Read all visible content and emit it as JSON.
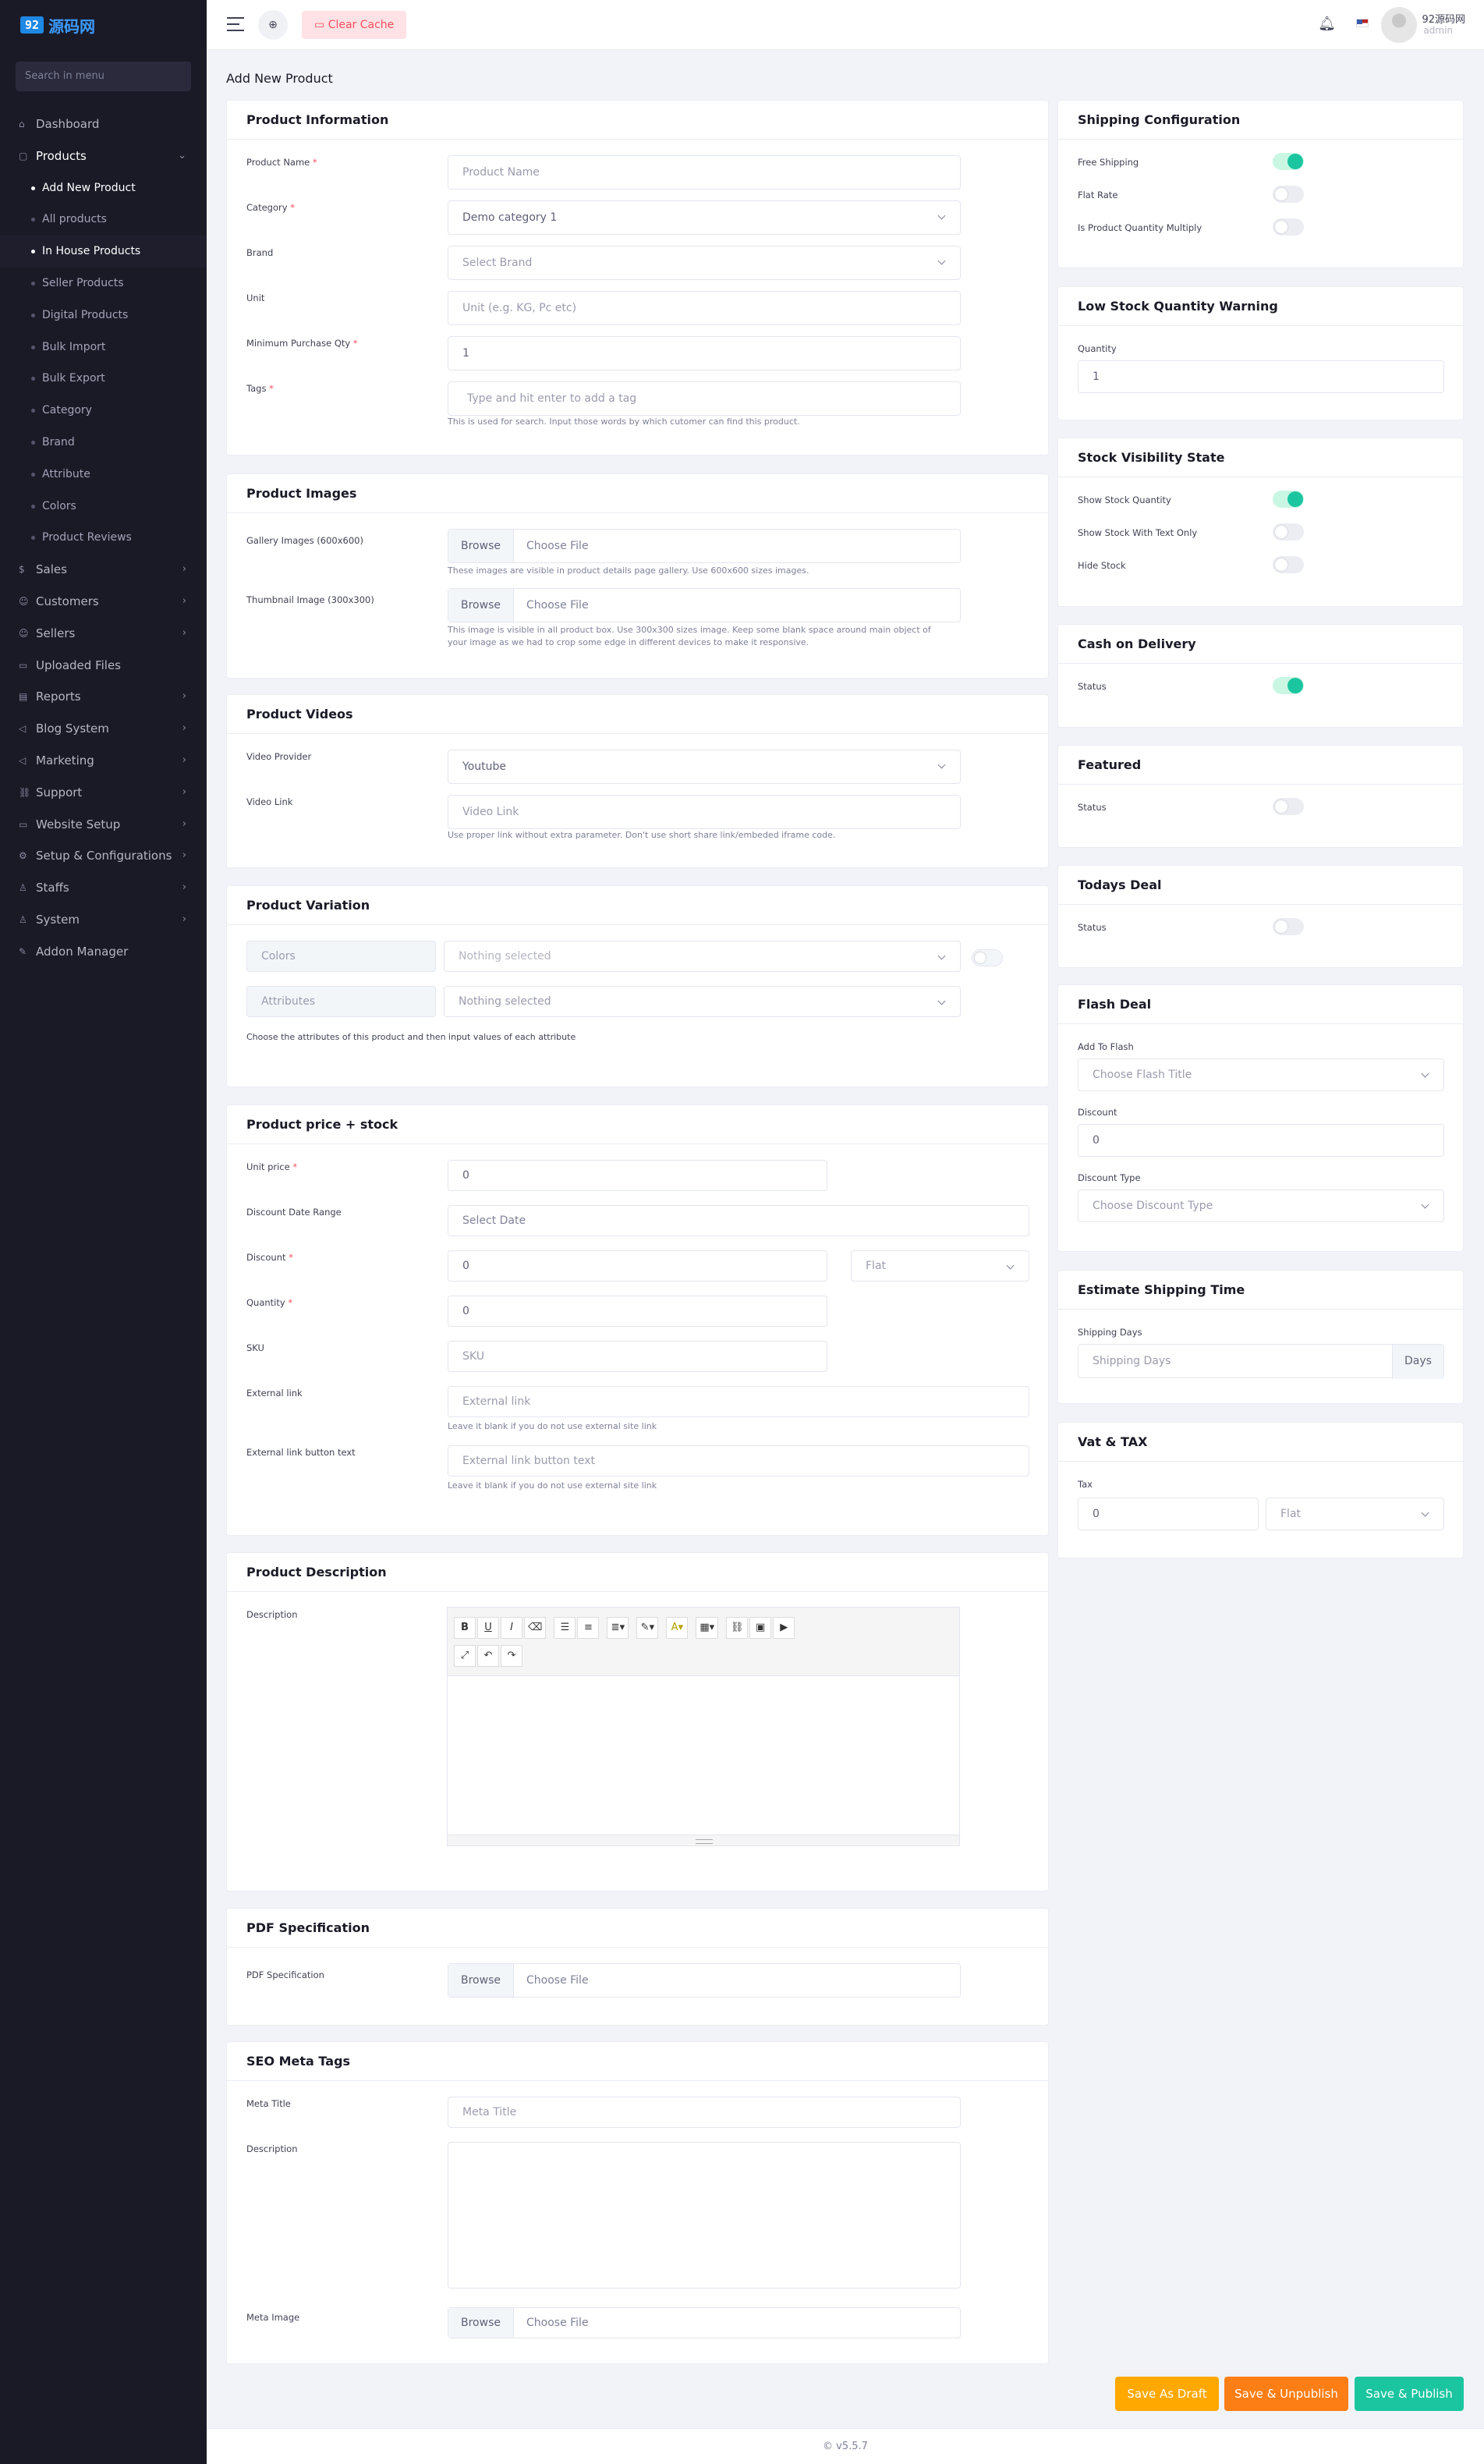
{
  "brand": {
    "logo_code": "92",
    "logo_name": "源码网"
  },
  "sidebar": {
    "search_placeholder": "Search in menu",
    "items": [
      {
        "label": "Dashboard",
        "icon": "home-icon",
        "chevron": false,
        "active": false
      },
      {
        "label": "Products",
        "icon": "box-icon",
        "chevron": true,
        "active": true,
        "expanded": true
      },
      {
        "label": "Sales",
        "icon": "money-icon",
        "chevron": true
      },
      {
        "label": "Customers",
        "icon": "users-icon",
        "chevron": true
      },
      {
        "label": "Sellers",
        "icon": "user-icon",
        "chevron": true
      },
      {
        "label": "Uploaded Files",
        "icon": "folder-icon",
        "chevron": false
      },
      {
        "label": "Reports",
        "icon": "file-icon",
        "chevron": true
      },
      {
        "label": "Blog System",
        "icon": "bullhorn-icon",
        "chevron": true
      },
      {
        "label": "Marketing",
        "icon": "bullhorn-icon",
        "chevron": true
      },
      {
        "label": "Support",
        "icon": "link-icon",
        "chevron": true
      },
      {
        "label": "Website Setup",
        "icon": "desktop-icon",
        "chevron": true
      },
      {
        "label": "Setup & Configurations",
        "icon": "gear-icon",
        "chevron": true
      },
      {
        "label": "Staffs",
        "icon": "user-tie-icon",
        "chevron": true
      },
      {
        "label": "System",
        "icon": "user-shield-icon",
        "chevron": true
      },
      {
        "label": "Addon Manager",
        "icon": "wrench-icon",
        "chevron": false
      }
    ],
    "product_sub": [
      "Add New Product",
      "All products",
      "In House Products",
      "Seller Products",
      "Digital Products",
      "Bulk Import",
      "Bulk Export",
      "Category",
      "Brand",
      "Attribute",
      "Colors",
      "Product Reviews"
    ]
  },
  "topbar": {
    "clear_cache": "Clear Cache",
    "user_name": "92源码网",
    "user_role": "admin"
  },
  "page_title": "Add New Product",
  "product_info": {
    "title": "Product Information",
    "name_label": "Product Name",
    "name_placeholder": "Product Name",
    "category_label": "Category",
    "category_value": "Demo category 1",
    "brand_label": "Brand",
    "brand_placeholder": "Select Brand",
    "unit_label": "Unit",
    "unit_placeholder": "Unit (e.g. KG, Pc etc)",
    "minqty_label": "Minimum Purchase Qty",
    "minqty_value": "1",
    "tags_label": "Tags",
    "tags_placeholder": "Type and hit enter to add a tag",
    "tags_help": "This is used for search. Input those words by which cutomer can find this product."
  },
  "product_images": {
    "title": "Product Images",
    "gallery_label": "Gallery Images (600x600)",
    "browse": "Browse",
    "choose_file": "Choose File",
    "gallery_help": "These images are visible in product details page gallery. Use 600x600 sizes images.",
    "thumb_label": "Thumbnail Image (300x300)",
    "thumb_help_1": "This image is visible in all product box. Use 300x300 sizes image. Keep some blank space around main object of",
    "thumb_help_2": "your image as we had to crop some edge in different devices to make it responsive."
  },
  "product_videos": {
    "title": "Product Videos",
    "provider_label": "Video Provider",
    "provider_value": "Youtube",
    "link_label": "Video Link",
    "link_placeholder": "Video Link",
    "link_help": "Use proper link without extra parameter. Don't use short share link/embeded iframe code."
  },
  "product_variation": {
    "title": "Product Variation",
    "colors": "Colors",
    "attributes": "Attributes",
    "nothing": "Nothing selected",
    "help": "Choose the attributes of this product and then input values of each attribute"
  },
  "price_stock": {
    "title": "Product price + stock",
    "unit_price_label": "Unit price",
    "unit_price_value": "0",
    "date_label": "Discount Date Range",
    "date_placeholder": "Select Date",
    "discount_label": "Discount",
    "discount_value": "0",
    "discount_type": "Flat",
    "quantity_label": "Quantity",
    "quantity_value": "0",
    "sku_label": "SKU",
    "sku_placeholder": "SKU",
    "ext_label": "External link",
    "ext_placeholder": "External link",
    "ext_help": "Leave it blank if you do not use external site link",
    "extbtn_label": "External link button text",
    "extbtn_placeholder": "External link button text",
    "extbtn_help": "Leave it blank if you do not use external site link"
  },
  "description": {
    "title": "Product Description",
    "label": "Description",
    "toolbar_row1": [
      {
        "name": "bold-icon",
        "glyph": "B"
      },
      {
        "name": "underline-icon",
        "glyph": "U"
      },
      {
        "name": "italic-icon",
        "glyph": "I"
      },
      {
        "name": "eraser-icon",
        "glyph": "⌫"
      },
      {
        "name": "unordered-list-icon",
        "glyph": "☰"
      },
      {
        "name": "ordered-list-icon",
        "glyph": "≡"
      },
      {
        "name": "align-icon",
        "glyph": "≣▾"
      },
      {
        "name": "magic-icon",
        "glyph": "✎▾"
      },
      {
        "name": "font-color-icon",
        "glyph": "A▾"
      },
      {
        "name": "table-icon",
        "glyph": "▦▾"
      },
      {
        "name": "link-icon",
        "glyph": "⛓"
      },
      {
        "name": "image-icon",
        "glyph": "▣"
      },
      {
        "name": "video-icon",
        "glyph": "▶"
      }
    ],
    "toolbar_row2": [
      {
        "name": "fullscreen-icon",
        "glyph": "⤢"
      },
      {
        "name": "undo-icon",
        "glyph": "↶"
      },
      {
        "name": "redo-icon",
        "glyph": "↷"
      }
    ]
  },
  "pdf": {
    "title": "PDF Specification",
    "label": "PDF Specification"
  },
  "seo": {
    "title": "SEO Meta Tags",
    "meta_title_label": "Meta Title",
    "meta_title_placeholder": "Meta Title",
    "desc_label": "Description",
    "image_label": "Meta Image"
  },
  "shipping": {
    "title": "Shipping Configuration",
    "free": "Free Shipping",
    "flat": "Flat Rate",
    "multiply": "Is Product Quantity Multiply",
    "free_on": true,
    "flat_on": false,
    "multiply_on": false
  },
  "low_stock": {
    "title": "Low Stock Quantity Warning",
    "label": "Quantity",
    "value": "1"
  },
  "visibility": {
    "title": "Stock Visibility State",
    "show_qty": "Show Stock Quantity",
    "show_text": "Show Stock With Text Only",
    "hide": "Hide Stock",
    "show_qty_on": true,
    "show_text_on": false,
    "hide_on": false
  },
  "cod": {
    "title": "Cash on Delivery",
    "status": "Status",
    "on": true
  },
  "featured": {
    "title": "Featured",
    "status": "Status",
    "on": false
  },
  "todays_deal": {
    "title": "Todays Deal",
    "status": "Status",
    "on": false
  },
  "flash": {
    "title": "Flash Deal",
    "add_label": "Add To Flash",
    "add_placeholder": "Choose Flash Title",
    "discount_label": "Discount",
    "discount_value": "0",
    "type_label": "Discount Type",
    "type_placeholder": "Choose Discount Type"
  },
  "est_shipping": {
    "title": "Estimate Shipping Time",
    "label": "Shipping Days",
    "placeholder": "Shipping Days",
    "suffix": "Days"
  },
  "vat": {
    "title": "Vat & TAX",
    "label": "Tax",
    "value": "0",
    "type": "Flat"
  },
  "actions": {
    "draft": "Save As Draft",
    "unpublish": "Save & Unpublish",
    "publish": "Save & Publish"
  },
  "colors": {
    "draft": "#ffa800",
    "unpublish": "#fd7e14",
    "publish": "#1bc5a0"
  },
  "footer": "© v5.5.7"
}
